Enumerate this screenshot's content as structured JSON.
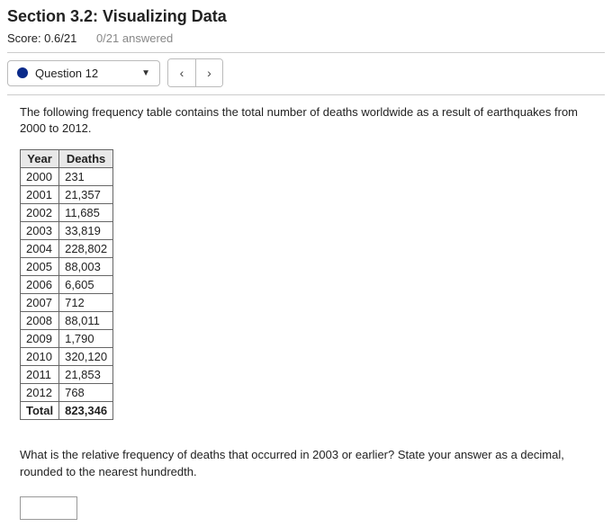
{
  "header": {
    "title": "Section 3.2: Visualizing Data",
    "score_label": "Score: 0.6/21",
    "answered_label": "0/21 answered"
  },
  "nav": {
    "question_select_label": "Question 12",
    "prev_icon": "‹",
    "next_icon": "›"
  },
  "question": {
    "prompt": "The following frequency table contains the total number of deaths worldwide as a result of earthquakes from 2000 to 2012.",
    "table": {
      "headers": [
        "Year",
        "Deaths"
      ],
      "rows": [
        {
          "year": "2000",
          "deaths": "231"
        },
        {
          "year": "2001",
          "deaths": "21,357"
        },
        {
          "year": "2002",
          "deaths": "11,685"
        },
        {
          "year": "2003",
          "deaths": "33,819"
        },
        {
          "year": "2004",
          "deaths": "228,802"
        },
        {
          "year": "2005",
          "deaths": "88,003"
        },
        {
          "year": "2006",
          "deaths": "6,605"
        },
        {
          "year": "2007",
          "deaths": "712"
        },
        {
          "year": "2008",
          "deaths": "88,011"
        },
        {
          "year": "2009",
          "deaths": "1,790"
        },
        {
          "year": "2010",
          "deaths": "320,120"
        },
        {
          "year": "2011",
          "deaths": "21,853"
        },
        {
          "year": "2012",
          "deaths": "768"
        }
      ],
      "total": {
        "label": "Total",
        "value": "823,346"
      }
    },
    "text": "What is the relative frequency of deaths that occurred in 2003 or earlier? State your answer as a decimal, rounded to the nearest hundredth.",
    "answer_value": ""
  }
}
